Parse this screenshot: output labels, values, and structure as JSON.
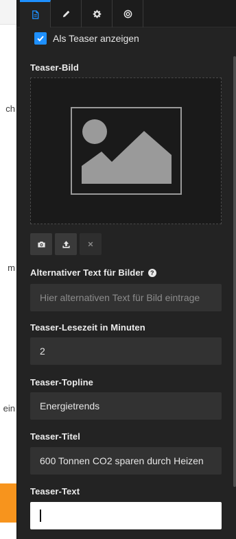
{
  "background_page": {
    "text_fragments": [
      "ch",
      "m",
      "ein"
    ],
    "accent_color": "#f7941d"
  },
  "tabs": [
    {
      "icon": "document-icon",
      "active": true
    },
    {
      "icon": "pencil-icon",
      "active": false
    },
    {
      "icon": "gear-icon",
      "active": false
    },
    {
      "icon": "target-icon",
      "active": false
    }
  ],
  "teaser_checkbox": {
    "label": "Als Teaser anzeigen",
    "checked": true
  },
  "teaser_image": {
    "label": "Teaser-Bild",
    "buttons": [
      "camera-icon",
      "upload-icon",
      "close-icon"
    ]
  },
  "alt_text": {
    "label": "Alternativer Text für Bilder",
    "placeholder": "Hier alternativen Text für Bild eintrage"
  },
  "reading_time": {
    "label": "Teaser-Lesezeit in Minuten",
    "value": "2"
  },
  "topline": {
    "label": "Teaser-Topline",
    "value": "Energietrends"
  },
  "title": {
    "label": "Teaser-Titel",
    "value": "600 Tonnen CO2 sparen durch Heizen"
  },
  "text": {
    "label": "Teaser-Text",
    "value": ""
  },
  "colors": {
    "accent": "#1e90ff",
    "panel_bg": "#232323",
    "field_bg": "#323232"
  }
}
